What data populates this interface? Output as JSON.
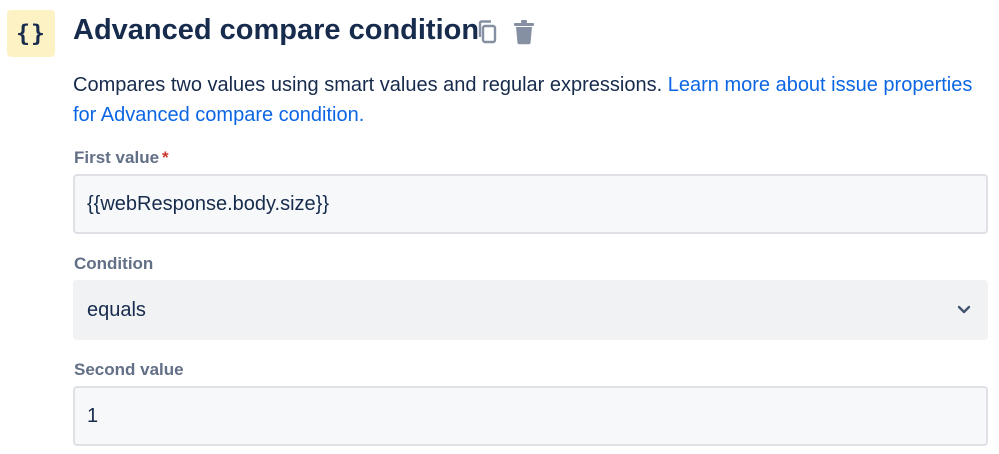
{
  "header": {
    "icon_glyph": "{}",
    "title": "Advanced compare condition",
    "actions": [
      {
        "name": "copy-icon"
      },
      {
        "name": "trash-icon"
      }
    ]
  },
  "description": {
    "text": "Compares two values using smart values and regular expressions.",
    "link_text": "Learn more about issue properties for Advanced compare condition."
  },
  "fields": {
    "first_value": {
      "label": "First value",
      "required_marker": "*",
      "value": "{{webResponse.body.size}}"
    },
    "condition": {
      "label": "Condition",
      "selected": "equals"
    },
    "second_value": {
      "label": "Second value",
      "value": "1"
    }
  },
  "colors": {
    "icon_bg": "#fdf2c4",
    "link": "#0c66e4",
    "required": "#c9372c",
    "label": "#626f86",
    "text": "#172b4d"
  }
}
